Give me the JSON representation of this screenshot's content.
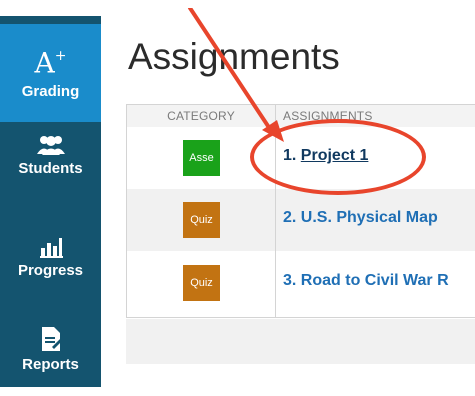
{
  "sidebar": {
    "items": [
      {
        "label": "Grading",
        "icon": "grading-icon",
        "glyph": "A",
        "glyph_sup": "+"
      },
      {
        "label": "Students",
        "icon": "students-icon"
      },
      {
        "label": "Progress",
        "icon": "progress-icon"
      },
      {
        "label": "Reports",
        "icon": "reports-icon"
      }
    ]
  },
  "page": {
    "title": "Assignments"
  },
  "table": {
    "headers": {
      "category": "CATEGORY",
      "assignments": "ASSIGNMENTS"
    },
    "rows": [
      {
        "category": "Asse",
        "category_color": "#1aa21a",
        "number": "1.",
        "name": "Project 1"
      },
      {
        "category": "Quiz",
        "category_color": "#c27312",
        "number": "2.",
        "name": "U.S. Physical Map"
      },
      {
        "category": "Quiz",
        "category_color": "#c27312",
        "number": "3.",
        "name": "Road to Civil War R"
      }
    ]
  },
  "colors": {
    "sidebar_bg": "#14546f",
    "sidebar_active": "#1a8ccb",
    "link": "#1f6fb5",
    "annotation": "#e8452c"
  }
}
